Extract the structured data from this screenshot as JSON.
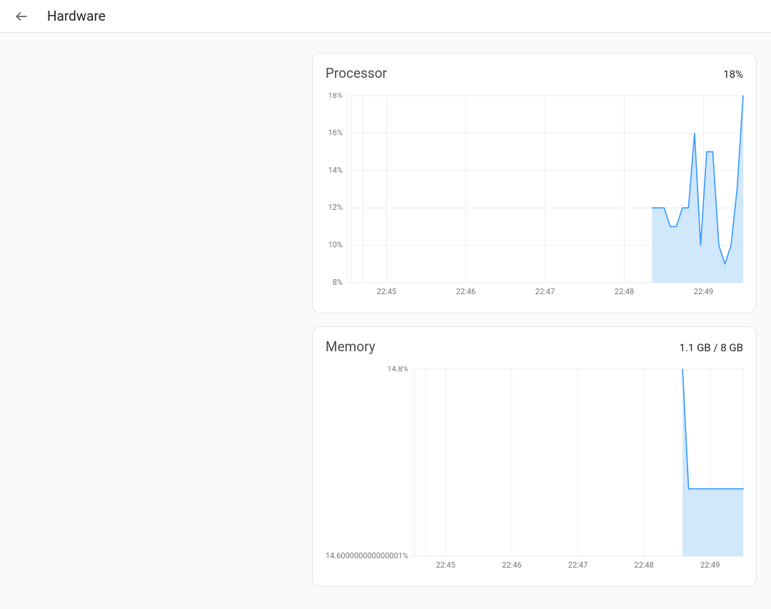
{
  "header": {
    "title": "Hardware"
  },
  "cards": {
    "processor": {
      "title": "Processor",
      "value": "18%"
    },
    "memory": {
      "title": "Memory",
      "value": "1.1 GB / 8 GB"
    }
  },
  "chart_data": [
    {
      "id": "processor",
      "type": "area",
      "title": "Processor",
      "ylabel": "",
      "y_ticks": [
        "8%",
        "10%",
        "12%",
        "14%",
        "16%",
        "18%"
      ],
      "x_ticks": [
        "22:45",
        "22:46",
        "22:47",
        "22:48",
        "22:49"
      ],
      "ylim": [
        8,
        18
      ],
      "xlim_sec": [
        0,
        300
      ],
      "data_start_sec": 231,
      "values": [
        12,
        12,
        12,
        11,
        11,
        12,
        12,
        16,
        10,
        15,
        15,
        10,
        9,
        10,
        13,
        18
      ],
      "color": "#3399ff",
      "fill": "#c9e3fb"
    },
    {
      "id": "memory",
      "type": "area",
      "title": "Memory",
      "ylabel": "",
      "y_ticks": [
        "14.600000000000001%",
        "14.8%"
      ],
      "x_ticks": [
        "22:45",
        "22:46",
        "22:47",
        "22:48",
        "22:49"
      ],
      "ylim": [
        14.6,
        14.8
      ],
      "xlim_sec": [
        0,
        300
      ],
      "data_start_sec": 245,
      "values": [
        14.8,
        14.672,
        14.672,
        14.672,
        14.672,
        14.672,
        14.672,
        14.672,
        14.672,
        14.672,
        14.672
      ],
      "color": "#3399ff",
      "fill": "#c9e3fb"
    }
  ]
}
